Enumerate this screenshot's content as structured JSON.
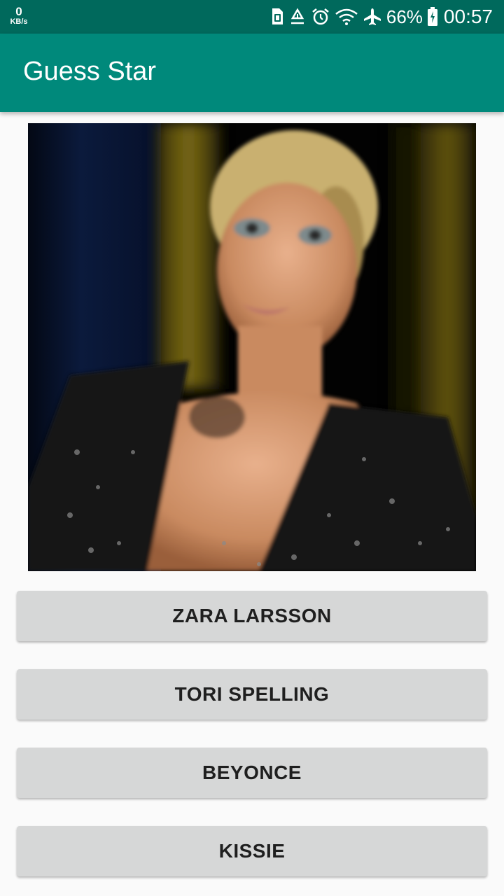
{
  "status_bar": {
    "net_speed_value": "0",
    "net_speed_unit": "KB/s",
    "battery_percent": "66%",
    "time": "00:57",
    "icons": [
      "sim-icon",
      "recycle-icon",
      "alarm-icon",
      "wifi-icon",
      "airplane-icon",
      "battery-icon"
    ]
  },
  "app_bar": {
    "title": "Guess Star"
  },
  "colors": {
    "status_bar": "#00695c",
    "app_bar": "#00897b",
    "button_bg": "#d6d7d7",
    "button_text": "#1f1f1f",
    "background": "#fafafa"
  },
  "main": {
    "answers": [
      {
        "label": "ZARA LARSSON"
      },
      {
        "label": "TORI SPELLING"
      },
      {
        "label": "BEYONCE"
      },
      {
        "label": "KISSIE"
      }
    ]
  }
}
